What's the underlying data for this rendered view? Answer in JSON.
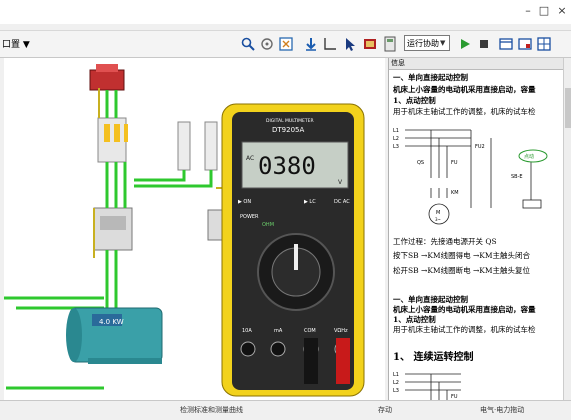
{
  "window": {
    "close_symbol": "×",
    "max_symbol": "□",
    "min_symbol": "–"
  },
  "toolbar": {
    "menu_text": "口置   ▼",
    "control_mode": "运行协助",
    "icons": [
      "search-icon",
      "pan-icon",
      "zoom-fit-icon",
      "download-icon",
      "measure-icon",
      "select-arrow-icon",
      "record-icon",
      "calculator-icon",
      "play-icon",
      "stop-icon",
      "layout-icon",
      "layout-alt-icon",
      "grid-icon"
    ]
  },
  "scene": {
    "motor_power": "4.0 KW",
    "multimeter": {
      "brand": "DIGITAL MULTIMETER",
      "model": "DT9205A",
      "reading": "0380",
      "mode": "AC",
      "unit": "V",
      "on_label": "▶ ON",
      "off_label": "▶ LC",
      "dcac": "DC AC",
      "power": "POWER",
      "ohm": "OHM",
      "ports": [
        "10A",
        "mA",
        "COM",
        "VΩHz"
      ]
    }
  },
  "info_panel": {
    "title": "信息",
    "lines": [
      {
        "text": "一、单向直接起动控制",
        "bold": true
      },
      {
        "text": "机床上小容量的电动机采用直接启动，容量",
        "bold": true
      },
      {
        "text": "1、点动控制",
        "bold": true
      },
      {
        "text": "用于机床主轴试工作的调整，机床的试车检",
        "bold": false
      },
      {
        "text": "工作过程：先接通电源开关 QS",
        "bold": false
      },
      {
        "text": "按下SB →KM线圈得电 →KM主触头闭合",
        "bold": false
      },
      {
        "text": "松开SB →KM线圈断电 →KM主触头复位",
        "bold": false
      },
      {
        "text": "一、单向直接起动控制",
        "bold": true
      },
      {
        "text": "机床上小容量的电动机采用直接启动，容量",
        "bold": true
      },
      {
        "text": "1、点动控制",
        "bold": true
      },
      {
        "text": "用于机床主轴试工作的调整，机床的试车检",
        "bold": false
      },
      {
        "text": "1、  连续运转控制",
        "bold": true
      }
    ],
    "diagram_labels": [
      "L1",
      "L2",
      "L3",
      "QS",
      "FU",
      "FU2",
      "SB-E",
      "点动",
      "KM",
      "M",
      "3~",
      "L1",
      "L2",
      "L3",
      "FU"
    ]
  },
  "status": {
    "left": "检测标准和测量曲线",
    "mid": "存动",
    "right": "电气·电力拖动"
  }
}
